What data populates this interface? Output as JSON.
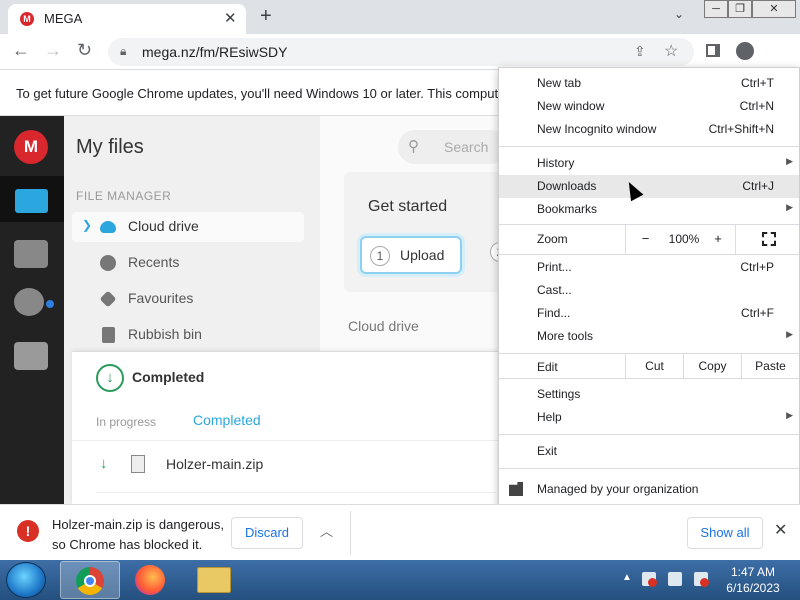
{
  "tab": {
    "title": "MEGA",
    "favicon": "mega-favicon"
  },
  "window_controls": {
    "minimize": "─",
    "maximize": "❐",
    "close": "✕"
  },
  "toolbar": {
    "url": "mega.nz/fm/REsiwSDY"
  },
  "infobar": {
    "text": "To get future Google Chrome updates, you'll need Windows 10 or later. This comput"
  },
  "mega": {
    "logo": "M",
    "heading": "My files",
    "section_label": "FILE MANAGER",
    "nav": [
      {
        "label": "Cloud drive",
        "icon": "cloud-icon"
      },
      {
        "label": "Recents",
        "icon": "clock-icon"
      },
      {
        "label": "Favourites",
        "icon": "heart-icon"
      },
      {
        "label": "Rubbish bin",
        "icon": "trash-icon"
      }
    ],
    "search_placeholder": "Search",
    "get_started": "Get started",
    "upload_step": "1",
    "upload_label": "Upload",
    "step2": "2",
    "breadcrumb": "Cloud drive"
  },
  "transfer": {
    "title": "Completed",
    "tab_inprogress": "In progress",
    "tab_completed": "Completed",
    "file": "Holzer-main.zip"
  },
  "menu": {
    "items1": [
      {
        "label": "New tab",
        "shortcut": "Ctrl+T"
      },
      {
        "label": "New window",
        "shortcut": "Ctrl+N"
      },
      {
        "label": "New Incognito window",
        "shortcut": "Ctrl+Shift+N"
      }
    ],
    "items2": [
      {
        "label": "History",
        "arrow": "▶"
      },
      {
        "label": "Downloads",
        "shortcut": "Ctrl+J"
      },
      {
        "label": "Bookmarks",
        "arrow": "▶"
      }
    ],
    "zoom": {
      "label": "Zoom",
      "minus": "−",
      "value": "100%",
      "plus": "+"
    },
    "items3": [
      {
        "label": "Print...",
        "shortcut": "Ctrl+P"
      },
      {
        "label": "Cast..."
      },
      {
        "label": "Find...",
        "shortcut": "Ctrl+F"
      },
      {
        "label": "More tools",
        "arrow": "▶"
      }
    ],
    "edit": {
      "label": "Edit",
      "cut": "Cut",
      "copy": "Copy",
      "paste": "Paste"
    },
    "items4": [
      {
        "label": "Settings"
      },
      {
        "label": "Help",
        "arrow": "▶"
      }
    ],
    "exit": "Exit",
    "managed": "Managed by your organization"
  },
  "shelf": {
    "warning": "Holzer-main.zip is dangerous, so Chrome has blocked it.",
    "discard": "Discard",
    "show_all": "Show all"
  },
  "taskbar": {
    "time": "1:47 AM",
    "date": "6/16/2023"
  }
}
